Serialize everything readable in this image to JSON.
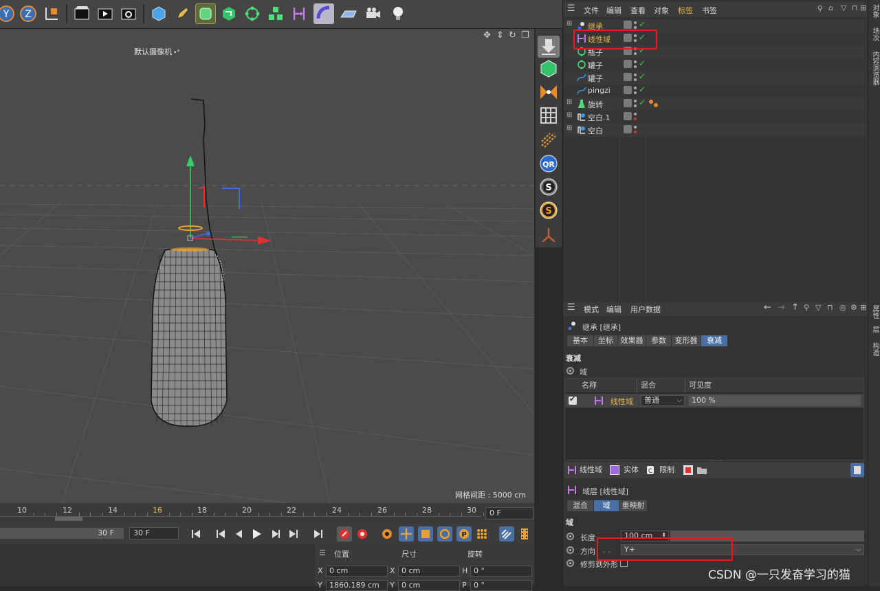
{
  "viewport": {
    "camera_label": "默认摄像机",
    "camera_suffix": "•°",
    "grid_spacing": "网格间距 : 5000 cm"
  },
  "toolbar": {
    "icons": [
      "y-axis-lock-icon",
      "z-axis-lock-icon",
      "coordinate-system-icon",
      "render-view-icon",
      "render-picture-viewer-icon",
      "render-settings-icon",
      "cube-icon",
      "pen-icon",
      "subdivision-icon",
      "extrude-icon",
      "mograph-cloner-icon",
      "array-icon",
      "linear-field-icon",
      "deformer-icon",
      "floor-icon",
      "camera-icon",
      "light-icon"
    ]
  },
  "timeline": {
    "ticks": [
      "10",
      "12",
      "14",
      "16",
      "18",
      "20",
      "22",
      "24",
      "26",
      "28",
      "30"
    ],
    "current_frame": "0 F",
    "end_frame_a": "30 F",
    "end_frame_b": "30 F"
  },
  "coords": {
    "position_header": "位置",
    "size_header": "尺寸",
    "rotation_header": "旋转",
    "pos_x_label": "X",
    "pos_x": "0 cm",
    "pos_y_label": "Y",
    "pos_y": "1860.189 cm",
    "size_x_label": "X",
    "size_x": "0 cm",
    "size_y_label": "Y",
    "size_y": "0 cm",
    "rot_h_label": "H",
    "rot_h": "0 °",
    "rot_p_label": "P",
    "rot_p": "0 °"
  },
  "object_manager": {
    "menu": [
      "文件",
      "编辑",
      "查看",
      "对象",
      "标签",
      "书签"
    ],
    "objects": [
      {
        "name": "继承",
        "color": "#e8b84a"
      },
      {
        "name": "线性域",
        "color": "#e8b84a"
      },
      {
        "name": "瓶子",
        "color": "#d6d6d6"
      },
      {
        "name": "罐子",
        "color": "#d6d6d6"
      },
      {
        "name": "罐子",
        "color": "#d6d6d6"
      },
      {
        "name": "pingzi",
        "color": "#d6d6d6"
      },
      {
        "name": "旋转",
        "color": "#d6d6d6"
      },
      {
        "name": "空白.1",
        "color": "#d6d6d6"
      },
      {
        "name": "空白",
        "color": "#d6d6d6"
      }
    ]
  },
  "attribute_manager": {
    "menu": [
      "模式",
      "编辑",
      "用户数据"
    ],
    "object_title": "继承 [继承]",
    "tabs": [
      "基本",
      "坐标",
      "效果器",
      "参数",
      "变形器",
      "衰减"
    ],
    "section_falloff": "衰减",
    "field_label": "域",
    "table_headers": [
      "名称",
      "混合",
      "可见度"
    ],
    "field_row": {
      "name": "线性域",
      "blend": "普通",
      "visibility": "100 %"
    },
    "field_buttons": [
      "线性域",
      "实体",
      "限制"
    ],
    "layer_title": "域层 [线性域]",
    "layer_tabs": [
      "混合",
      "域",
      "重映射"
    ],
    "section_field": "域",
    "length_label": "长度",
    "length_value": "100 cm",
    "direction_label": "方向",
    "direction_prefix": ". .",
    "direction_value": "Y+",
    "clip_label": "修剪到外形"
  },
  "side_tabs": [
    "对象",
    "场次",
    "内容浏览器",
    "属性",
    "层",
    "构造"
  ],
  "watermark": "CSDN @一只发奋学习的猫",
  "colors": {
    "accent": "#4a6fa5",
    "highlight_box": "#e02020",
    "selected_text": "#e8b84a"
  }
}
